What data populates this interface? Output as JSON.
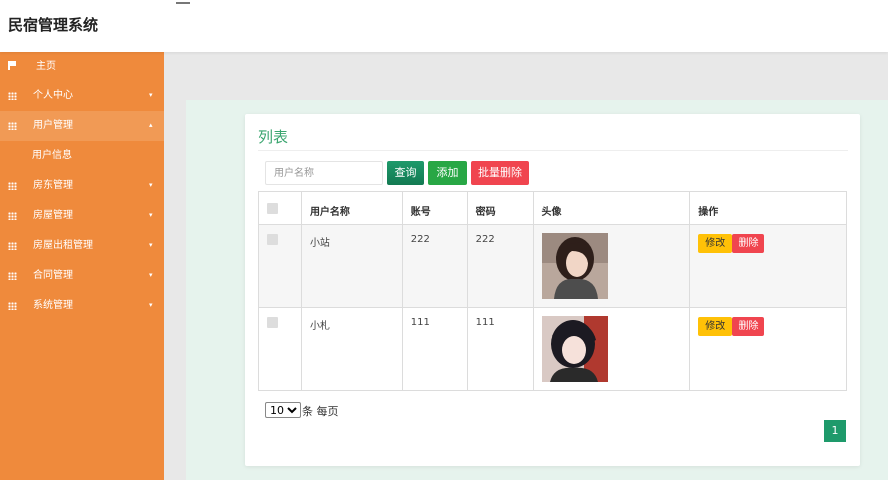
{
  "app": {
    "title": "民宿管理系统"
  },
  "sidebar": {
    "items": [
      {
        "label": "主页",
        "icon": "flag-icon",
        "caret": ""
      },
      {
        "label": "个人中心",
        "icon": "grid-icon",
        "caret": "▾"
      },
      {
        "label": "用户管理",
        "icon": "grid-icon",
        "caret": "▴",
        "active": true
      },
      {
        "label": "房东管理",
        "icon": "grid-icon",
        "caret": "▾"
      },
      {
        "label": "房屋管理",
        "icon": "grid-icon",
        "caret": "▾"
      },
      {
        "label": "房屋出租管理",
        "icon": "grid-icon",
        "caret": "▾"
      },
      {
        "label": "合同管理",
        "icon": "grid-icon",
        "caret": "▾"
      },
      {
        "label": "系统管理",
        "icon": "grid-icon",
        "caret": "▾"
      }
    ],
    "subitem": "用户信息"
  },
  "main": {
    "title": "列表",
    "search": {
      "placeholder": "用户名称"
    },
    "buttons": {
      "query": "查询",
      "add": "添加",
      "batch_delete": "批量删除"
    },
    "table": {
      "headers": [
        "",
        "用户名称",
        "账号",
        "密码",
        "头像",
        "操作"
      ],
      "rows": [
        {
          "name": "小站",
          "account": "222",
          "password": "222"
        },
        {
          "name": "小札",
          "account": "111",
          "password": "111"
        }
      ],
      "actions": {
        "edit": "修改",
        "delete": "删除"
      }
    },
    "pagination": {
      "page_size": "10",
      "page_size_label": "条 每页",
      "current_page": "1"
    }
  },
  "colors": {
    "sidebar": "#ef8a3c",
    "accent": "#3aa56f",
    "query": "#1e9a6b",
    "add": "#28a745",
    "danger": "#f0454f",
    "edit": "#ffc107"
  }
}
